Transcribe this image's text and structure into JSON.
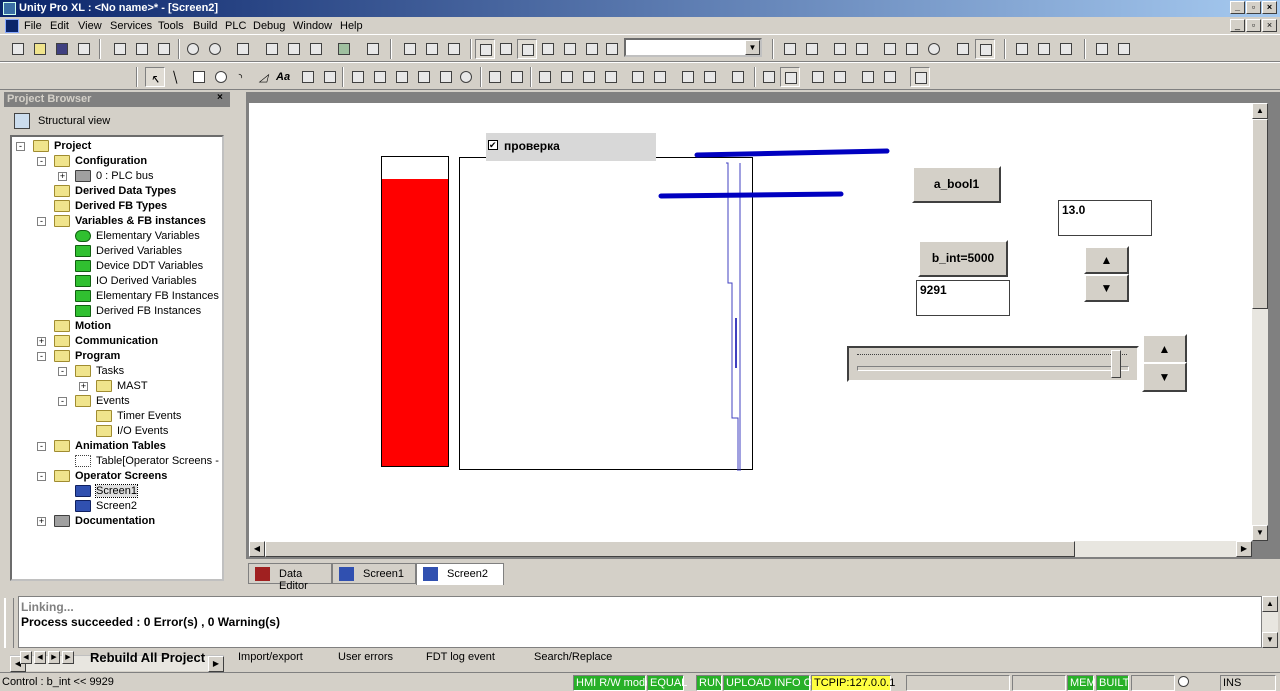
{
  "window": {
    "title": "Unity Pro XL : <No name>* - [Screen2]"
  },
  "menu": [
    "File",
    "Edit",
    "View",
    "Services",
    "Tools",
    "Build",
    "PLC",
    "Debug",
    "Window",
    "Help"
  ],
  "project_browser": {
    "title": "Project Browser",
    "view": "Structural view",
    "tree": [
      {
        "label": "Project",
        "bold": true
      },
      {
        "label": "Configuration",
        "bold": true
      },
      {
        "label": "0 : PLC bus",
        "bold": false
      },
      {
        "label": "Derived Data Types",
        "bold": true
      },
      {
        "label": "Derived FB Types",
        "bold": true
      },
      {
        "label": "Variables & FB instances",
        "bold": true
      },
      {
        "label": "Elementary Variables",
        "bold": false
      },
      {
        "label": "Derived Variables",
        "bold": false
      },
      {
        "label": "Device DDT Variables",
        "bold": false
      },
      {
        "label": "IO Derived Variables",
        "bold": false
      },
      {
        "label": "Elementary FB Instances",
        "bold": false
      },
      {
        "label": "Derived FB Instances",
        "bold": false
      },
      {
        "label": "Motion",
        "bold": true
      },
      {
        "label": "Communication",
        "bold": true
      },
      {
        "label": "Program",
        "bold": true
      },
      {
        "label": "Tasks",
        "bold": false
      },
      {
        "label": "MAST",
        "bold": false
      },
      {
        "label": "Events",
        "bold": false
      },
      {
        "label": "Timer Events",
        "bold": false
      },
      {
        "label": "I/O Events",
        "bold": false
      },
      {
        "label": "Animation Tables",
        "bold": true
      },
      {
        "label": "Table[Operator Screens - S",
        "bold": false
      },
      {
        "label": "Operator Screens",
        "bold": true
      },
      {
        "label": "Screen1",
        "bold": false
      },
      {
        "label": "Screen2",
        "bold": false
      },
      {
        "label": "Documentation",
        "bold": true
      }
    ]
  },
  "screen": {
    "checkbox_label": "проверка",
    "checkbox_mark": "✔",
    "bool_button": "a_bool1",
    "int_button": "b_int=5000",
    "field_int": "9291",
    "field_real": "13.0",
    "bar_level": 0.93,
    "slider_level": 0.97,
    "colors": {
      "bar": "#ff0000",
      "trend_line": "#0000c0",
      "trend_trace": "#4040c0"
    }
  },
  "doc_tabs": [
    "Data Editor",
    "Screen1",
    "Screen2"
  ],
  "output": {
    "lines": [
      "Linking...",
      "Process succeeded : 0 Error(s) , 0 Warning(s)"
    ],
    "tabs": [
      "Rebuild All Project",
      "Import/export",
      "User errors",
      "FDT log event",
      "Search/Replace"
    ]
  },
  "status": {
    "left": "Control : b_int << 9929",
    "panels": [
      "HMI R/W mode",
      "EQUAL",
      "RUN",
      "UPLOAD INFO OK",
      "TCPIP:127.0.0.1",
      "MEM",
      "BUILT",
      "INS"
    ]
  }
}
